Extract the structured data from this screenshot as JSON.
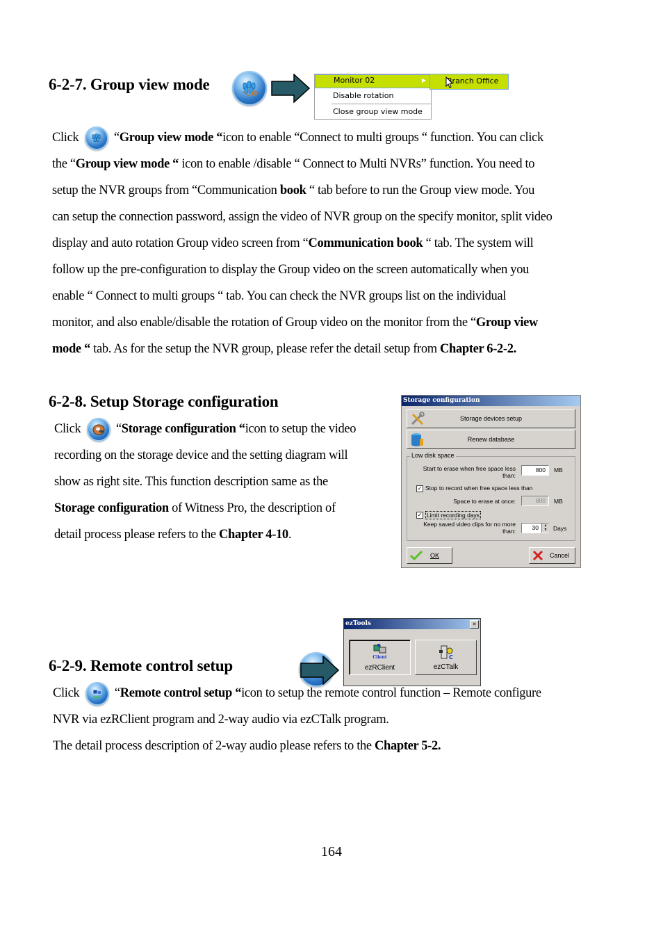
{
  "section_627": {
    "heading": "6-2-7.  Group view mode",
    "icon": "group-view-mode-icon",
    "menu": {
      "items": [
        {
          "label": "Monitor 02",
          "has_submenu": true,
          "active": true
        },
        {
          "label": "Disable rotation"
        },
        {
          "label": "Close group view mode"
        }
      ],
      "submenu": [
        {
          "label": "Branch Office",
          "active": true
        }
      ]
    },
    "highlight_color": "#c5e000",
    "paragraph": [
      {
        "segments": [
          {
            "t": "Click "
          },
          {
            "icon": "group-view-mode-icon"
          },
          {
            "t": " “"
          },
          {
            "b": "Group view mode “"
          },
          {
            "t": "icon to enable “Connect to multi groups “ function.    You can click"
          }
        ]
      },
      {
        "segments": [
          {
            "t": "the “"
          },
          {
            "b": "Group view mode “"
          },
          {
            "t": " icon to enable /disable “ Connect to Multi NVRs” function.    You need to"
          }
        ]
      },
      {
        "segments": [
          {
            "t": "setup the NVR groups from “Communication "
          },
          {
            "b": "book"
          },
          {
            "t": " “ tab before to run the Group view mode.      You"
          }
        ]
      },
      {
        "segments": [
          {
            "t": "can setup the connection password, assign the video of NVR group on the specify monitor, split video"
          }
        ]
      },
      {
        "segments": [
          {
            "t": "display and auto rotation Group video screen from “"
          },
          {
            "b": "Communication book"
          },
          {
            "t": " “ tab.    The system will"
          }
        ]
      },
      {
        "segments": [
          {
            "t": "follow up the pre-configuration to display the Group video on the screen automatically when you"
          }
        ]
      },
      {
        "segments": [
          {
            "t": "enable “ Connect to multi groups “ tab.    You can check the NVR groups list on the individual"
          }
        ]
      },
      {
        "segments": [
          {
            "t": "monitor, and also enable/disable the rotation of Group video on the monitor from the “"
          },
          {
            "b": "Group view"
          }
        ]
      },
      {
        "segments": [
          {
            "b": "mode “"
          },
          {
            "t": " tab.    As for the setup the NVR group, please refer the detail setup from "
          },
          {
            "b": "Chapter 6-2-2."
          }
        ]
      }
    ]
  },
  "section_628": {
    "heading": "6-2-8.  Setup Storage configuration",
    "paragraph": [
      {
        "segments": [
          {
            "t": "Click "
          },
          {
            "icon": "storage-configuration-icon"
          },
          {
            "t": "  “"
          },
          {
            "b": "Storage configuration “"
          },
          {
            "t": "icon to setup the video"
          }
        ]
      },
      {
        "segments": [
          {
            "t": "recording on the storage device and the setting diagram will"
          }
        ]
      },
      {
        "segments": [
          {
            "t": "show as right site.    This function description same as the"
          }
        ]
      },
      {
        "segments": [
          {
            "b": "Storage configuration"
          },
          {
            "t": " of Witness Pro, the description of"
          }
        ]
      },
      {
        "segments": [
          {
            "t": "detail process please refers to the "
          },
          {
            "b": "Chapter 4-10"
          },
          {
            "t": "."
          }
        ]
      }
    ],
    "dialog": {
      "title": "Storage configuration",
      "storage_devices_button": "Storage devices setup",
      "renew_database_button": "Renew database",
      "group_label": "Low disk space",
      "start_erase_label": "Start to erase when free space less than:",
      "start_erase_value": "800",
      "start_erase_unit": "MB",
      "stop_record_checked": true,
      "stop_record_label": "Stop to record when free space less than",
      "space_erase_label": "Space to erase at once:",
      "space_erase_value": "800",
      "space_erase_unit": "MB",
      "limit_days_checked": true,
      "limit_days_label": "Limit recording days",
      "keep_clips_label": "Keep saved video clips for no more than:",
      "keep_clips_value": "30",
      "keep_clips_unit": "Days",
      "ok_button": "OK",
      "cancel_button": "Cancel"
    }
  },
  "section_629": {
    "heading": "6-2-9.  Remote control setup",
    "dialog": {
      "title": "ezTools",
      "close_glyph": "✕",
      "client_icon_caption": "Client",
      "buttons": [
        {
          "label": "ezRClient"
        },
        {
          "label": "ezCTalk"
        }
      ]
    },
    "paragraph": [
      {
        "segments": [
          {
            "t": "Click "
          },
          {
            "icon": "remote-control-icon"
          },
          {
            "t": " “"
          },
          {
            "b": "Remote control setup “"
          },
          {
            "t": "icon to setup the remote control function – Remote configure"
          }
        ]
      },
      {
        "segments": [
          {
            "t": "NVR via ezRClient program and 2-way audio via ezCTalk program."
          }
        ]
      },
      {
        "segments": [
          {
            "t": "The detail process description of 2-way audio please refers to the "
          },
          {
            "b": "Chapter 5-2."
          }
        ]
      }
    ]
  },
  "page_number": "164"
}
